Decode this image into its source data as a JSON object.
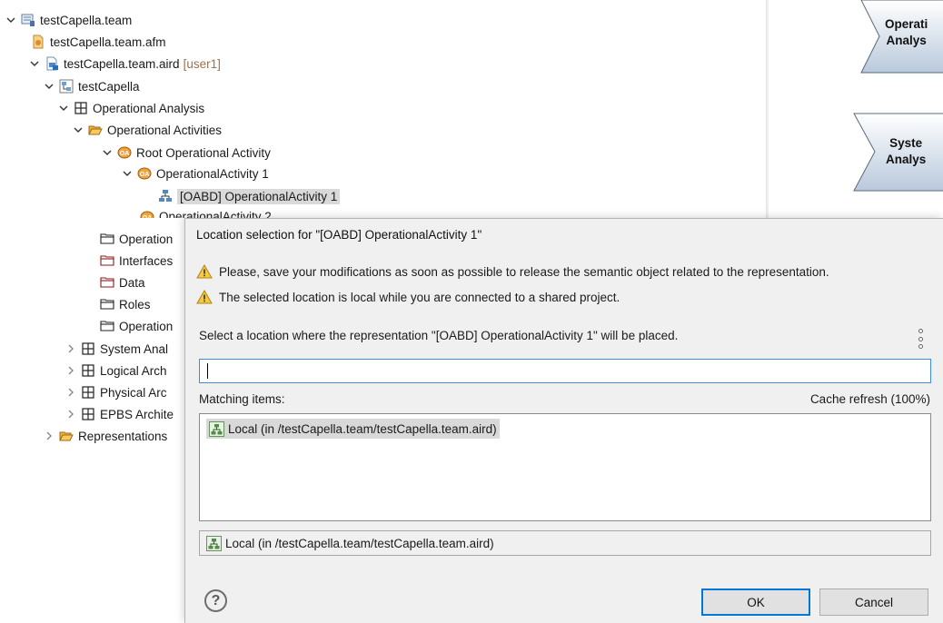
{
  "tree": {
    "items": [
      {
        "label": "testCapella.team",
        "icon": "team-project-icon"
      },
      {
        "label": "testCapella.team.afm",
        "icon": "afm-file-icon"
      },
      {
        "label": "testCapella.team.aird",
        "suffix": "[user1]",
        "icon": "aird-file-icon"
      },
      {
        "label": "testCapella",
        "icon": "model-icon"
      },
      {
        "label": "Operational Analysis",
        "icon": "package-grid-icon"
      },
      {
        "label": "Operational Activities",
        "icon": "folder-open-icon"
      },
      {
        "label": "Root Operational Activity",
        "icon": "operational-activity-icon"
      },
      {
        "label": "OperationalActivity 1",
        "icon": "operational-activity-icon"
      },
      {
        "label": "[OABD] OperationalActivity 1",
        "icon": "diagram-icon"
      },
      {
        "label": "OperationalActivity 2",
        "icon": "operational-activity-icon"
      },
      {
        "label": "Operation",
        "icon": "folder-icon"
      },
      {
        "label": "Interfaces",
        "icon": "folder-icon"
      },
      {
        "label": "Data",
        "icon": "folder-icon"
      },
      {
        "label": "Roles",
        "icon": "folder-icon"
      },
      {
        "label": "Operation",
        "icon": "folder-icon"
      },
      {
        "label": "System Anal",
        "icon": "package-grid-icon"
      },
      {
        "label": "Logical Arch",
        "icon": "package-grid-icon"
      },
      {
        "label": "Physical Arc",
        "icon": "package-grid-icon"
      },
      {
        "label": "EPBS Archite",
        "icon": "package-grid-icon"
      },
      {
        "label": "Representations",
        "icon": "folder-icon"
      }
    ]
  },
  "diagram": {
    "shapes": [
      {
        "line1": "Operati",
        "line2": "Analys"
      },
      {
        "line1": "Syste",
        "line2": "Analys"
      }
    ]
  },
  "dialog": {
    "title": "Location selection for \"[OABD] OperationalActivity 1\"",
    "warnings": [
      "Please, save your modifications as soon as possible to release the semantic object related to the representation.",
      "The selected location is local while you are connected to a shared project."
    ],
    "instruction": "Select a location where the representation \"[OABD] OperationalActivity 1\" will be placed.",
    "filter": {
      "value": "",
      "placeholder": ""
    },
    "matching_label": "Matching items:",
    "cache_status": "Cache refresh (100%)",
    "results": [
      "Local (in /testCapella.team/testCapella.team.aird)"
    ],
    "selected_location": "Local (in /testCapella.team/testCapella.team.aird)",
    "help_label": "?",
    "ok_label": "OK",
    "cancel_label": "Cancel"
  }
}
